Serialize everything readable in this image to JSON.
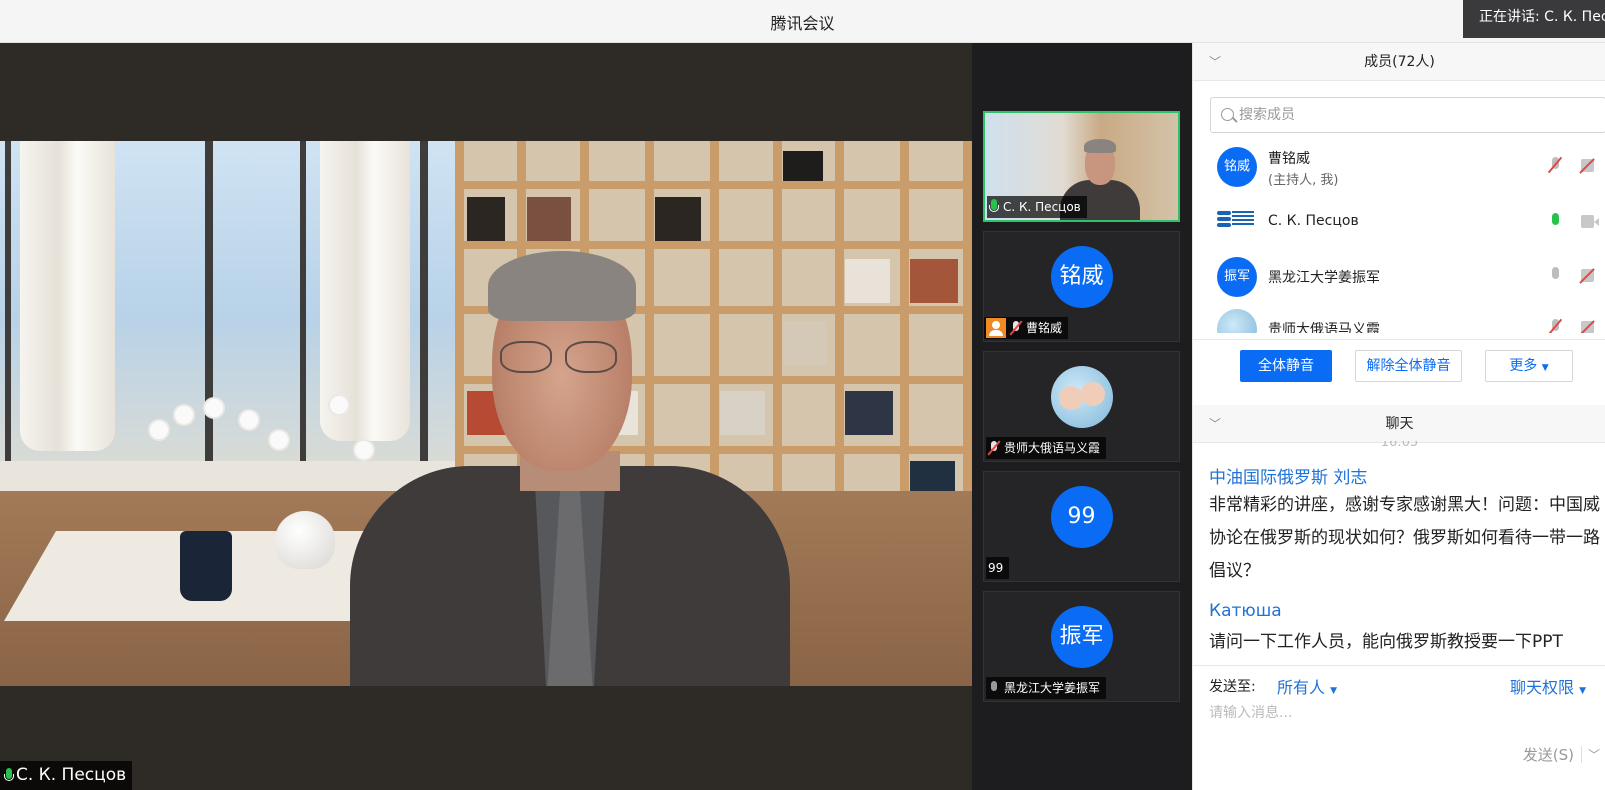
{
  "app": {
    "title": "腾讯会议",
    "speaking": "正在讲话: С. К. Пес"
  },
  "main_video": {
    "speaker_name": "С. К. Песцов"
  },
  "thumbnails": [
    {
      "name": "С. К. Песцов",
      "type": "video",
      "mic": "on"
    },
    {
      "name": "曹铭威",
      "avatar_text": "铭威",
      "type": "avatar",
      "mic": "muted",
      "host": true
    },
    {
      "name": "贵师大俄语马义霞",
      "type": "photo",
      "mic": "muted"
    },
    {
      "name": "99",
      "avatar_text": "99",
      "type": "avatar",
      "mic": "none"
    },
    {
      "name": "黑龙江大学姜振军",
      "avatar_text": "振军",
      "type": "avatar",
      "mic": "gray"
    }
  ],
  "members": {
    "header": "成员(72人)",
    "search_placeholder": "搜索成员",
    "items": [
      {
        "avatar_text": "铭威",
        "name": "曹铭威",
        "sub": "(主持人, 我)",
        "mic": "muted",
        "camera": "muted"
      },
      {
        "avatar_text": "",
        "name": "С. К. Песцов",
        "sub": "",
        "mic": "active",
        "camera": "on"
      },
      {
        "avatar_text": "振军",
        "name": "黑龙江大学姜振军",
        "sub": "",
        "mic": "idle",
        "camera": "muted"
      },
      {
        "avatar_text": "",
        "name": "贵师大俄语马义霞",
        "sub": "",
        "mic": "muted",
        "camera": "muted"
      }
    ],
    "mute_all": "全体静音",
    "unmute_all": "解除全体静音",
    "more": "更多"
  },
  "chat": {
    "header": "聊天",
    "time": "16:05",
    "messages": [
      {
        "sender": "中油国际俄罗斯 刘志",
        "text": "非常精彩的讲座，感谢专家感谢黑大！问题：中国威协论在俄罗斯的现状如何？俄罗斯如何看待一带一路倡议？"
      },
      {
        "sender": "Катюша",
        "text": "请问一下工作人员，能向俄罗斯教授要一下PPT"
      }
    ],
    "send_to_label": "发送至:",
    "send_to_value": "所有人",
    "permission": "聊天权限",
    "input_placeholder": "请输入消息...",
    "send": "发送(S)"
  },
  "colors": {
    "accent": "#0a6cf5",
    "link": "#1f73d8",
    "speaking_green": "#27c24c",
    "muted_red": "#e54545"
  }
}
